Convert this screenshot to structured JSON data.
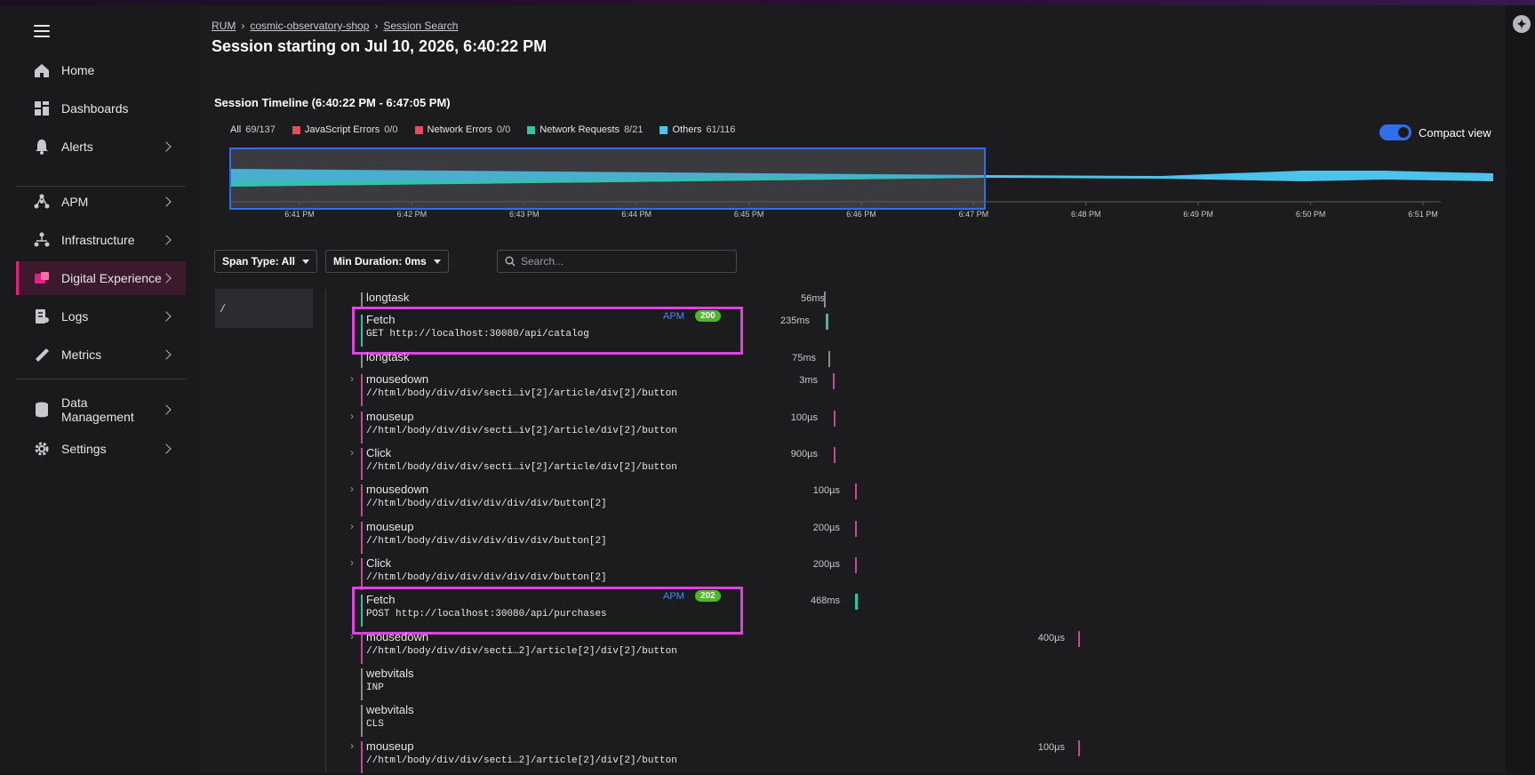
{
  "sidebar": {
    "items": [
      {
        "label": "Home",
        "icon": "home-icon",
        "chevron": false
      },
      {
        "label": "Dashboards",
        "icon": "dashboards-icon",
        "chevron": false
      },
      {
        "label": "Alerts",
        "icon": "bell-icon",
        "chevron": true
      },
      {
        "label": "APM",
        "icon": "apm-icon",
        "chevron": true
      },
      {
        "label": "Infrastructure",
        "icon": "infrastructure-icon",
        "chevron": true
      },
      {
        "label": "Digital Experience",
        "icon": "digital-experience-icon",
        "chevron": true,
        "active": true
      },
      {
        "label": "Logs",
        "icon": "logs-icon",
        "chevron": true
      },
      {
        "label": "Metrics",
        "icon": "metrics-icon",
        "chevron": true
      },
      {
        "label": "Data Management",
        "icon": "database-icon",
        "chevron": true
      },
      {
        "label": "Settings",
        "icon": "gear-icon",
        "chevron": true
      }
    ]
  },
  "breadcrumb": [
    "RUM",
    "cosmic-observatory-shop",
    "Session Search"
  ],
  "page_title": "Session starting on Jul 10, 2026, 6:40:22 PM",
  "timeline": {
    "title": "Session Timeline (6:40:22 PM - 6:47:05 PM)",
    "legend": [
      {
        "label": "All",
        "count": "69/137",
        "color": ""
      },
      {
        "label": "JavaScript Errors",
        "count": "0/0",
        "color": "#e84b5a"
      },
      {
        "label": "Network Errors",
        "count": "0/0",
        "color": "#e84b5a"
      },
      {
        "label": "Network Requests",
        "count": "8/21",
        "color": "#2ec6a0"
      },
      {
        "label": "Others",
        "count": "61/116",
        "color": "#4cc3ea"
      }
    ],
    "compact_view_label": "Compact view",
    "compact_view_on": true,
    "ticks": [
      "6:41 PM",
      "6:42 PM",
      "6:43 PM",
      "6:44 PM",
      "6:45 PM",
      "6:46 PM",
      "6:47 PM",
      "6:48 PM",
      "6:49 PM",
      "6:50 PM",
      "6:51 PM"
    ]
  },
  "filters": {
    "span_type": "Span Type: All",
    "min_duration": "Min Duration: 0ms",
    "search_placeholder": "Search..."
  },
  "path": "/",
  "spans": [
    {
      "name": "longtask",
      "sub": "",
      "duration": "56ms",
      "color": "#8a8a92",
      "expandable": false
    },
    {
      "name": "Fetch",
      "sub": "GET http://localhost:30080/api/catalog",
      "duration": "235ms",
      "color": "#2ec6a0",
      "expandable": false,
      "apm": "APM",
      "status": "200",
      "highlighted": true
    },
    {
      "name": "longtask",
      "sub": "",
      "duration": "75ms",
      "color": "#8a8a92",
      "expandable": false
    },
    {
      "name": "mousedown",
      "sub": "//html/body/div/div/secti…iv[2]/article/div[2]/button",
      "duration": "3ms",
      "color": "#c846a0",
      "expandable": true
    },
    {
      "name": "mouseup",
      "sub": "//html/body/div/div/secti…iv[2]/article/div[2]/button",
      "duration": "100µs",
      "color": "#c846a0",
      "expandable": true
    },
    {
      "name": "Click",
      "sub": "//html/body/div/div/secti…iv[2]/article/div[2]/button",
      "duration": "900µs",
      "color": "#c846a0",
      "expandable": true
    },
    {
      "name": "mousedown",
      "sub": "//html/body/div/div/div/div/div/button[2]",
      "duration": "100µs",
      "color": "#c846a0",
      "expandable": true
    },
    {
      "name": "mouseup",
      "sub": "//html/body/div/div/div/div/div/button[2]",
      "duration": "200µs",
      "color": "#c846a0",
      "expandable": true
    },
    {
      "name": "Click",
      "sub": "//html/body/div/div/div/div/div/button[2]",
      "duration": "200µs",
      "color": "#c846a0",
      "expandable": true
    },
    {
      "name": "Fetch",
      "sub": "POST http://localhost:30080/api/purchases",
      "duration": "468ms",
      "color": "#2ec6a0",
      "expandable": false,
      "apm": "APM",
      "status": "202",
      "highlighted": true
    },
    {
      "name": "mousedown",
      "sub": "//html/body/div/div/secti…2]/article[2]/div[2]/button",
      "duration": "400µs",
      "color": "#c846a0",
      "expandable": true
    },
    {
      "name": "webvitals",
      "sub": "INP",
      "duration": "",
      "color": "#8a8a92",
      "expandable": false
    },
    {
      "name": "webvitals",
      "sub": "CLS",
      "duration": "",
      "color": "#8a8a92",
      "expandable": false
    },
    {
      "name": "mouseup",
      "sub": "//html/body/div/div/secti…2]/article[2]/div[2]/button",
      "duration": "100µs",
      "color": "#c846a0",
      "expandable": true
    }
  ]
}
